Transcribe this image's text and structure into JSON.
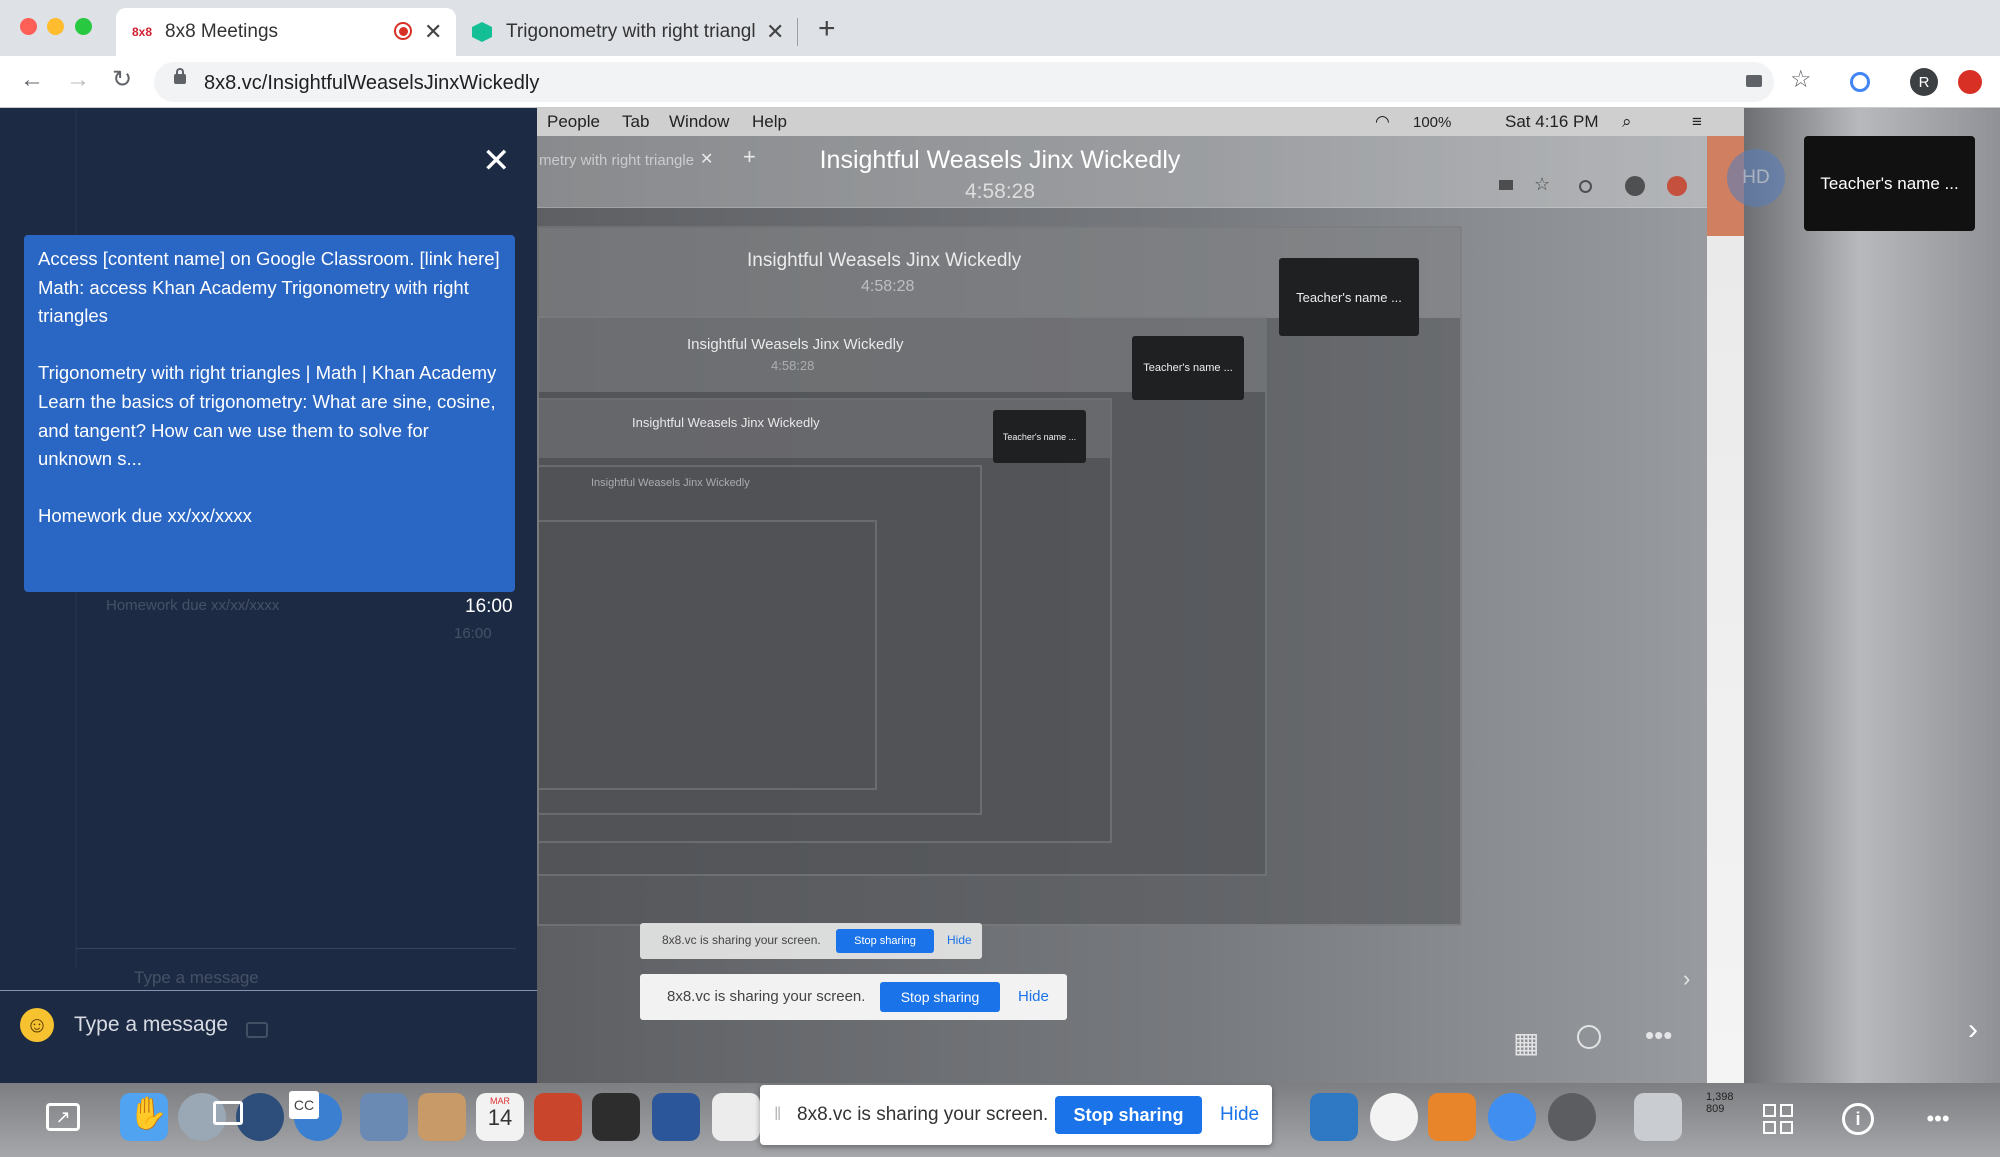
{
  "browser": {
    "tabs": [
      {
        "favicon": "8x8",
        "title": "8x8 Meetings"
      },
      {
        "title": "Trigonometry with right triangle"
      }
    ],
    "url": "8x8.vc/InsightfulWeaselsJinxWickedly",
    "new_tab": "+",
    "profile_initial": "R"
  },
  "shared_screen": {
    "menu": [
      "People",
      "Tab",
      "Window",
      "Help"
    ],
    "status": {
      "battery": "100%",
      "time": "Sat 4:16 PM"
    },
    "inner_tab": "metry with right triangle",
    "nested_title": "Insightful Weasels Jinx Wickedly",
    "nested_timer": "4:58:28",
    "nested_tile": "Teacher's name ...",
    "nested_share_text": "8x8.vc is sharing your screen.",
    "nested_stop": "Stop sharing",
    "nested_hide": "Hide",
    "hd": "HD"
  },
  "meeting": {
    "title": "Insightful Weasels Jinx Wickedly",
    "timer": "4:58:28",
    "hd_label": "HD",
    "teacher_tile": "Teacher's name ..."
  },
  "chat": {
    "message": {
      "line1": "Access [content name] on Google Classroom. [link here]",
      "line2": "Math: access Khan Academy Trigonometry with right triangles",
      "line3": "Trigonometry with right triangles | Math | Khan Academy",
      "line4": "Learn the basics of trigonometry: What are sine, cosine, and tangent? How can we use them to solve for unknown s...",
      "line5": "Homework due xx/xx/xxxx",
      "time": "16:00"
    },
    "ghost_homework": "Homework due xx/xx/xxxx",
    "ghost_time": "16:00",
    "ghost_placeholder": "Type a message",
    "input_placeholder": "Type a message",
    "close": "✕"
  },
  "toolbar": {
    "cc": "CC"
  },
  "sharing_bar": {
    "text": "8x8.vc is sharing your screen.",
    "stop": "Stop sharing",
    "hide": "Hide"
  },
  "dock": {
    "calendar_month": "MAR",
    "calendar_day": "14",
    "side_number": "1,398 809"
  }
}
